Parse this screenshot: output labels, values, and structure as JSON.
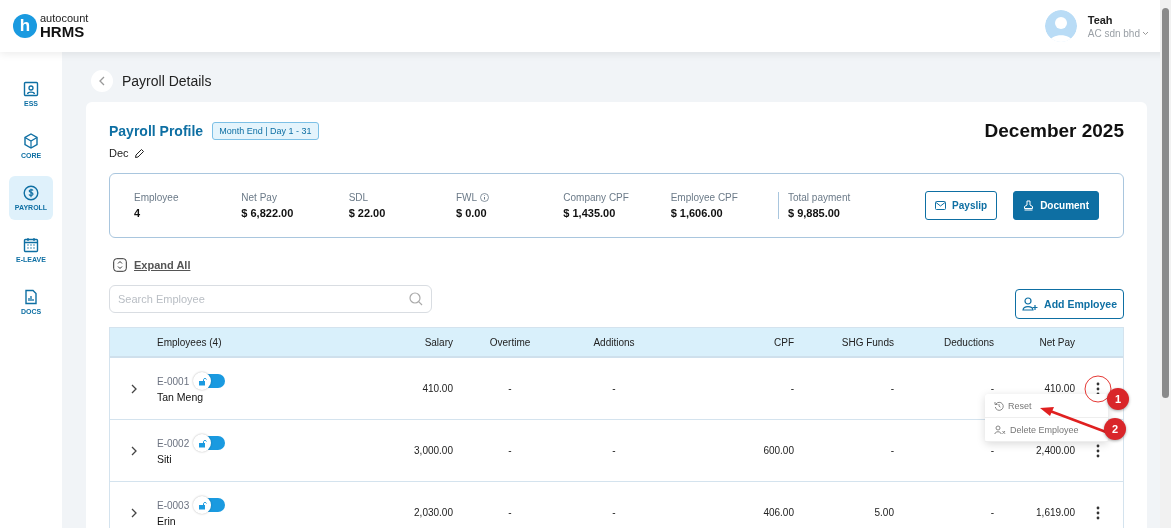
{
  "brand": {
    "mark": "h",
    "name_top": "autocount",
    "name_bottom": "HRMS"
  },
  "user": {
    "name": "Teah",
    "company": "AC sdn bhd"
  },
  "sidebar": {
    "items": [
      {
        "label": "ESS",
        "kind": "ess",
        "selected": false
      },
      {
        "label": "CORE",
        "kind": "core",
        "selected": false
      },
      {
        "label": "PAYROLL",
        "kind": "payroll",
        "selected": true
      },
      {
        "label": "E-LEAVE",
        "kind": "leave",
        "selected": false
      },
      {
        "label": "DOCS",
        "kind": "docs",
        "selected": false
      }
    ]
  },
  "page_title": "Payroll Details",
  "profile": {
    "title": "Payroll Profile",
    "badge": "Month End | Day 1 - 31",
    "name": "Dec",
    "period": "December 2025"
  },
  "summary": {
    "items": [
      {
        "label": "Employee",
        "value": "4",
        "kind": "plain"
      },
      {
        "label": "Net Pay",
        "value": "$ 6,822.00",
        "kind": "plain"
      },
      {
        "label": "SDL",
        "value": "$ 22.00",
        "kind": "plain"
      },
      {
        "label": "FWL",
        "value": "$ 0.00",
        "kind": "info"
      },
      {
        "label": "Company CPF",
        "value": "$ 1,435.00",
        "kind": "plain"
      },
      {
        "label": "Employee CPF",
        "value": "$ 1,606.00",
        "kind": "plain"
      },
      {
        "label": "Total payment",
        "value": "$ 9,885.00",
        "kind": "total"
      }
    ],
    "buttons": [
      {
        "label": "Payslip",
        "kind": "outline"
      },
      {
        "label": "Document",
        "kind": "primary"
      }
    ]
  },
  "expand_all": "Expand All",
  "search": {
    "placeholder": "Search Employee"
  },
  "add_employee": "Add Employee",
  "table": {
    "employee_column": "Employees (4)",
    "columns": [
      "Salary",
      "Overtime",
      "Additions",
      "CPF",
      "SHG Funds",
      "Deductions",
      "Net Pay"
    ],
    "rows": [
      {
        "code": "E-0001",
        "name": "Tan Meng",
        "cells": [
          "410.00",
          "-",
          "-",
          "-",
          "-",
          "-",
          "410.00"
        ]
      },
      {
        "code": "E-0002",
        "name": "Siti",
        "cells": [
          "3,000.00",
          "-",
          "-",
          "600.00",
          "-",
          "-",
          "2,400.00"
        ]
      },
      {
        "code": "E-0003",
        "name": "Erin",
        "cells": [
          "2,030.00",
          "-",
          "-",
          "406.00",
          "5.00",
          "-",
          "1,619.00"
        ]
      }
    ]
  },
  "row_menu": {
    "items": [
      {
        "label": "Reset",
        "kind": "reset"
      },
      {
        "label": "Delete Employee",
        "kind": "delete"
      }
    ]
  },
  "annotations": [
    {
      "label": "1"
    },
    {
      "label": "2"
    }
  ]
}
